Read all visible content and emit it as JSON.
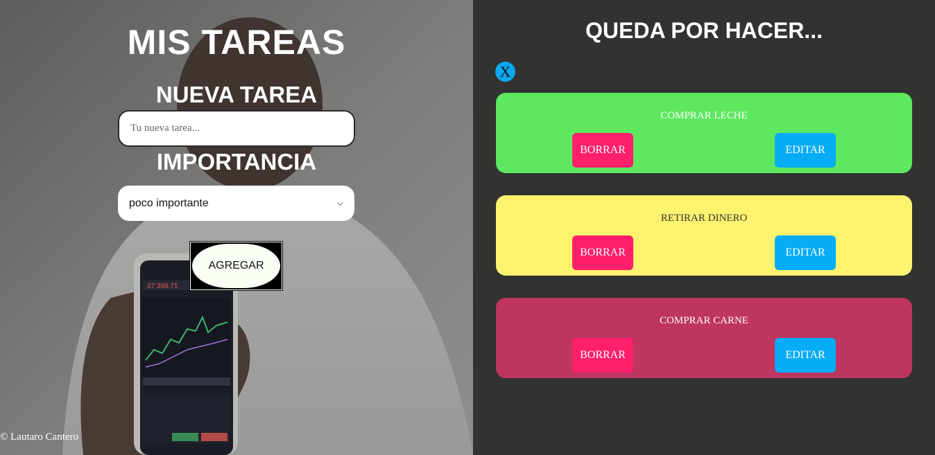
{
  "left_panel": {
    "title": "MIS TAREAS",
    "new_task_heading": "NUEVA TAREA",
    "task_input": {
      "placeholder": "Tu nueva tarea...",
      "value": ""
    },
    "importance_heading": "IMPORTANCIA",
    "importance_select": {
      "selected": "poco importante"
    },
    "add_button_label": "AGREGAR",
    "footer": "© Lautaro Cantero"
  },
  "right_panel": {
    "title": "QUEDA POR HACER...",
    "close_button_label": "X",
    "tasks": [
      {
        "name": "COMPRAR LECHE",
        "delete_label": "BORRAR",
        "edit_label": "EDITAR",
        "color": "#5de85f",
        "text_color": "#ffffff"
      },
      {
        "name": "RETIRAR DINERO",
        "delete_label": "BORRAR",
        "edit_label": "EDITAR",
        "color": "#fdf36f",
        "text_color": "#333333"
      },
      {
        "name": "COMPRAR CARNE",
        "delete_label": "BORRAR",
        "edit_label": "EDITAR",
        "color": "#be3560",
        "text_color": "#ffffff"
      }
    ]
  },
  "colors": {
    "right_background": "#323230",
    "delete_button": "#ff1f6b",
    "edit_button": "#07acf6",
    "close_button": "#0da8f2"
  }
}
